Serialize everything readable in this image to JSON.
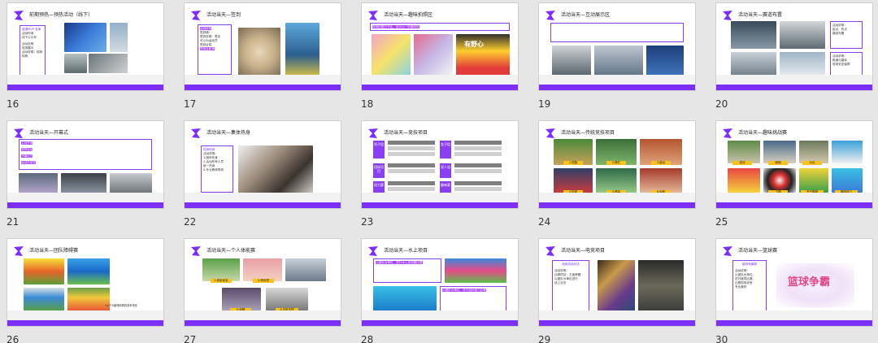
{
  "slides": [
    {
      "num": "16",
      "title": "前期预热—预热活动（线下）",
      "text": [
        "邀请MVP 名单",
        "活动时间",
        "线下公众号",
        "活动说明",
        "现场展示 ",
        "活动说明：现场特殊"
      ]
    },
    {
      "num": "17",
      "title": "活动当天—签到",
      "text": [
        "活动说明",
        "签到墙：",
        "签到说明：签名",
        "可以为运动员",
        "签到台前",
        "现场合影等"
      ]
    },
    {
      "num": "18",
      "title": "活动当天—趣味拍照区",
      "text": [
        "现场拍照打卡区，设计以一些趣味的",
        "有野心"
      ]
    },
    {
      "num": "19",
      "title": "活动当天—互动展示区",
      "labels": [
        "1.健身互动展区",
        "2.Wii 体感游戏互动",
        "3.体感VR"
      ]
    },
    {
      "num": "20",
      "title": "活动当天—赛道布置",
      "text": [
        "活动说明：",
        "起点、终点",
        "路线布置",
        "活动说明：",
        "跑道与路标",
        "现场安全保障"
      ]
    },
    {
      "num": "21",
      "title": "活动当天—开幕式",
      "text": [
        "主持开场",
        "领导讲话",
        "开幕仪式",
        "运动员宣誓"
      ]
    },
    {
      "num": "22",
      "title": "活动当天—集体热身",
      "text": [
        "热身时间",
        "活动说明：",
        "1.团体热身",
        "2.活动所有人员",
        "统一热身",
        "3.专业教练带领"
      ]
    },
    {
      "num": "23",
      "title": "活动当天—竞技项目",
      "blocks": [
        "男子组",
        "女子组",
        "团体项目",
        "双人组",
        "接力赛",
        "趣味赛"
      ]
    },
    {
      "num": "24",
      "title": "活动当天—传统竞技项目",
      "labels": [
        "1.短跑",
        "2.跨栏",
        "3.跳远",
        "4.铅球",
        "5.跳高",
        "6.标枪"
      ]
    },
    {
      "num": "25",
      "title": "活动当天—趣味挑战赛",
      "labels": [
        "拔河",
        "跳绳",
        "沙包",
        "飞镖",
        "充气障碍",
        "趣味接力"
      ]
    },
    {
      "num": "26",
      "title": "活动当天—团队障碍赛",
      "text": [
        "*以下为趣味障碍赛参考场景"
      ]
    },
    {
      "num": "27",
      "title": "活动当天—个人体能赛",
      "labels": [
        "1.仰卧起坐",
        "2.俯卧撑",
        "3.深蹲",
        "4.平板支撑"
      ]
    },
    {
      "num": "28",
      "title": "活动当天—水上项目",
      "text": [
        "以团队为单位，进行水上皮划艇比赛",
        "以团队为单位，进行游泳接力比赛"
      ]
    },
    {
      "num": "29",
      "title": "活动当天—电竞项目",
      "text": [
        "电竞游戏对决",
        "活动说明：",
        "比赛项目：王者荣耀",
        "以团队为单位进行",
        "线上对决"
      ]
    },
    {
      "num": "30",
      "title": "活动当天—篮球赛",
      "text": [
        "篮球争霸赛",
        "活动说明：",
        "以团队为单位，",
        "进行篮球比赛，",
        "比赛现场设有",
        "专业裁判"
      ],
      "art": "篮球争霸"
    }
  ]
}
